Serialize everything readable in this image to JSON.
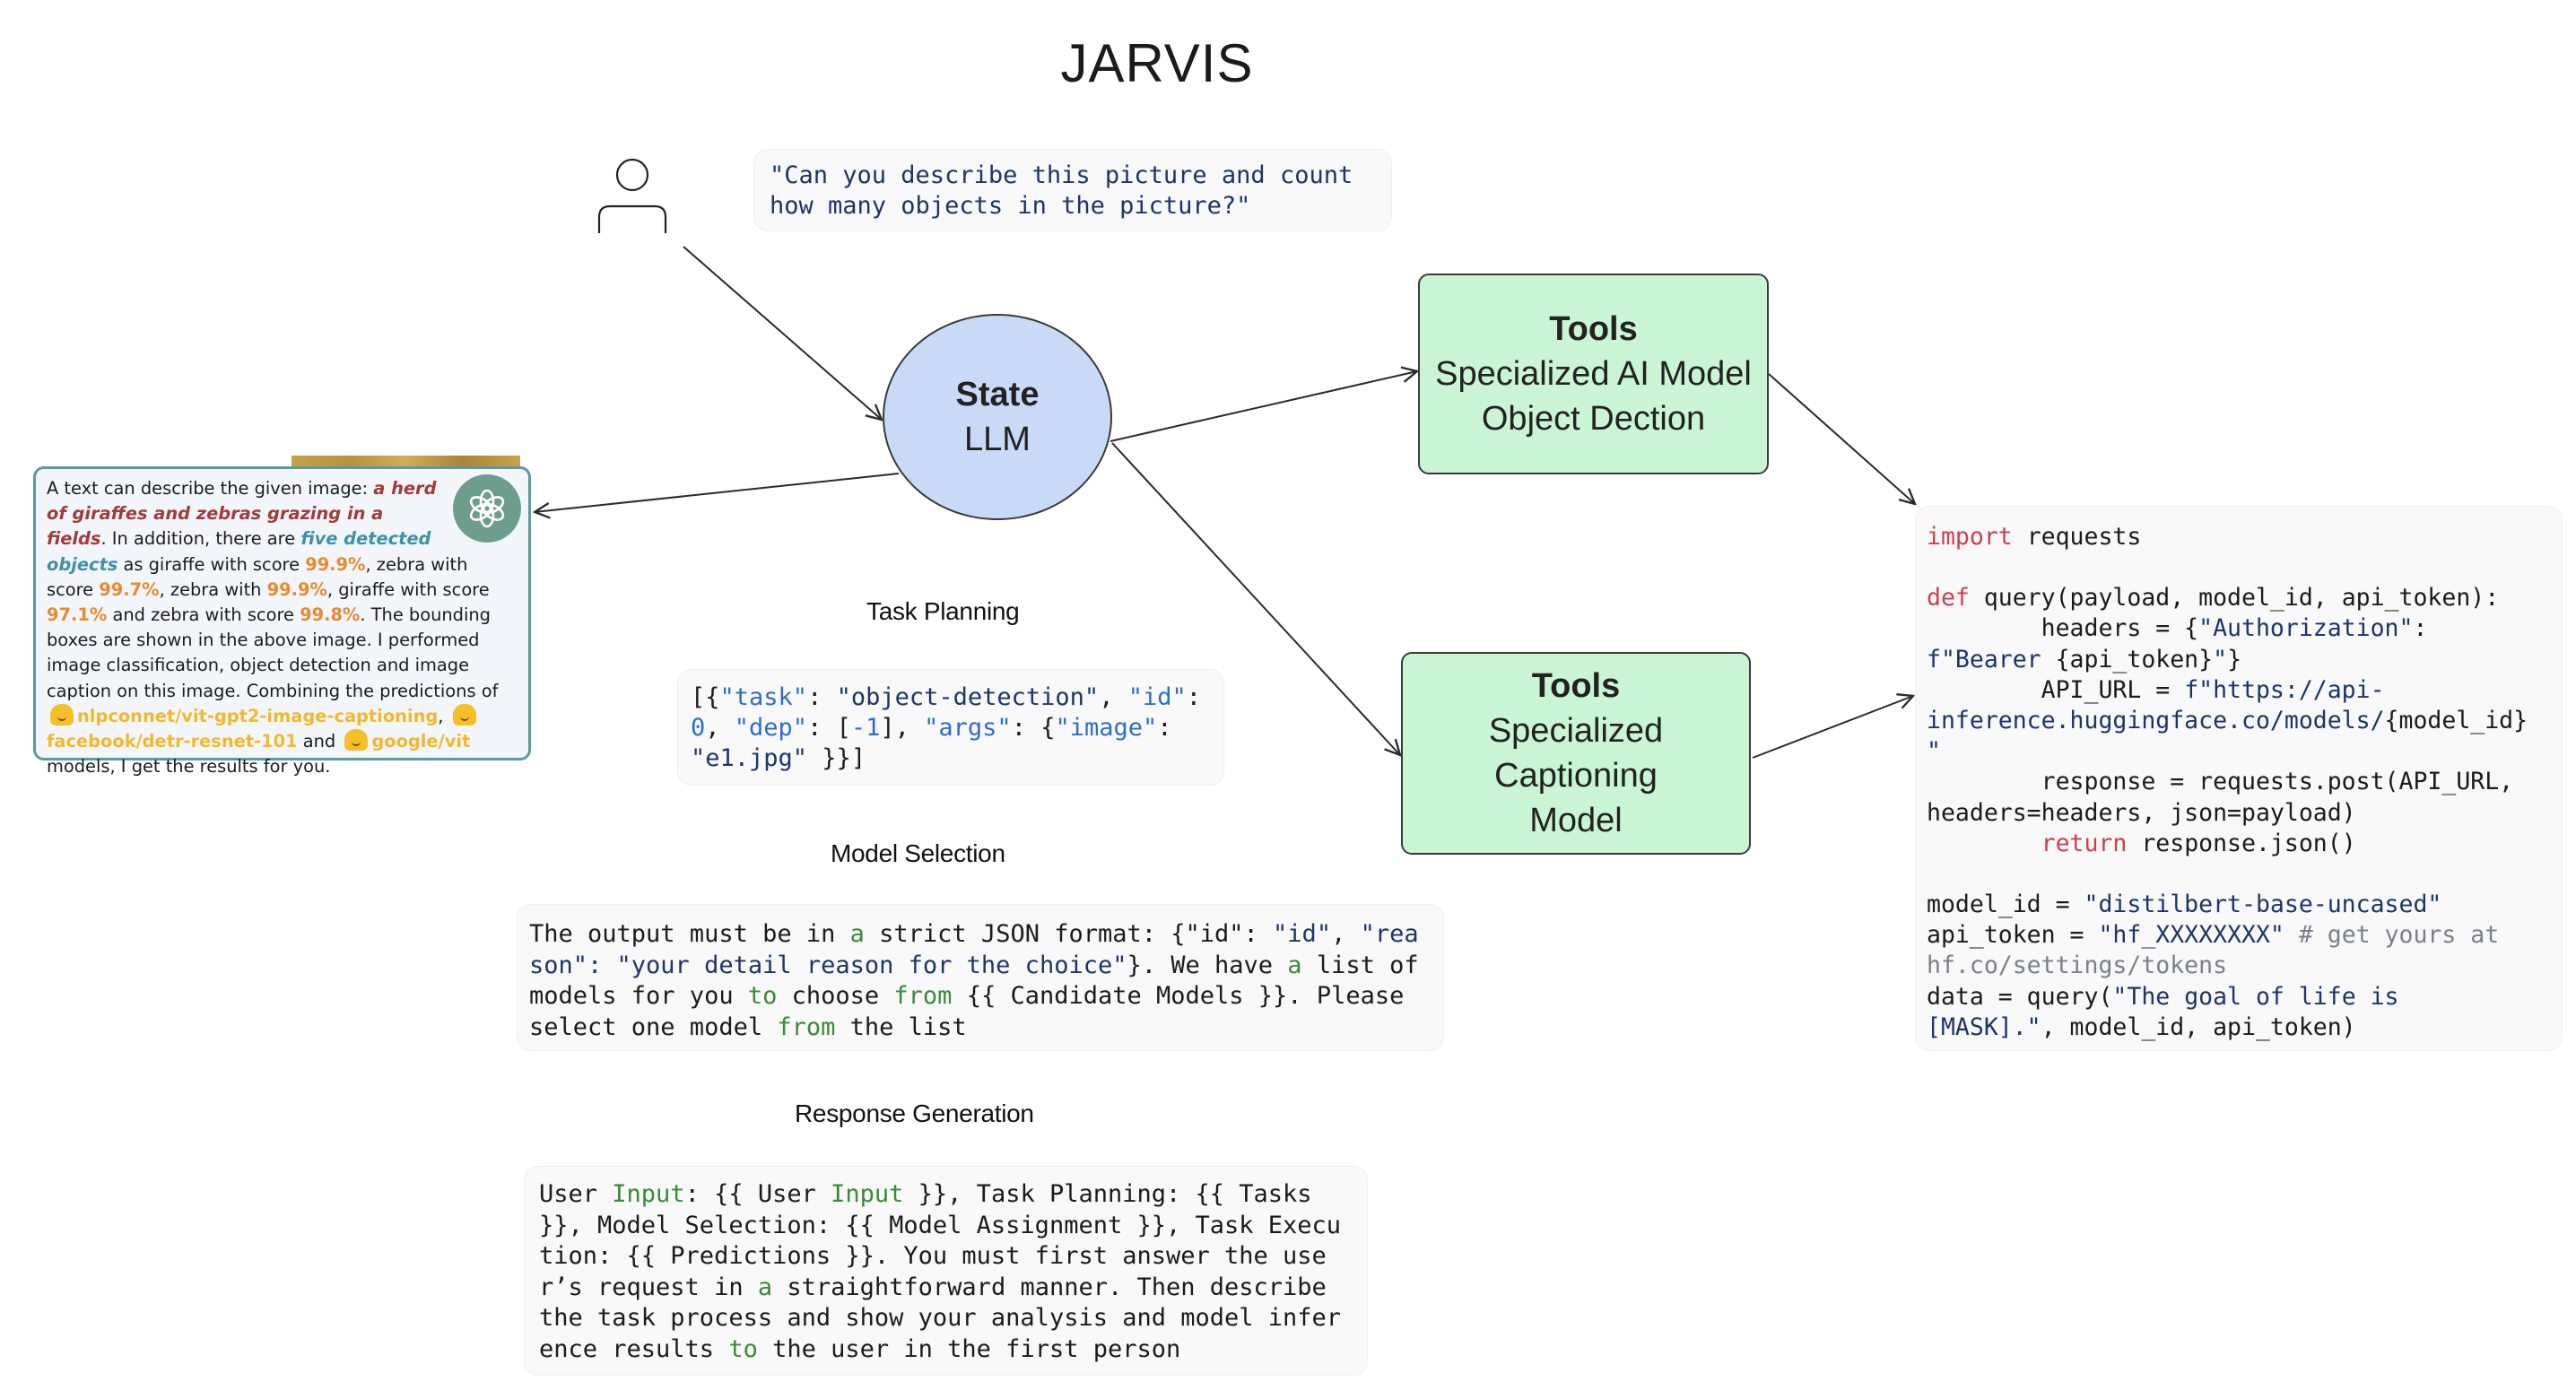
{
  "title": "JARVIS",
  "user_query": "\"Can you describe this picture and count how many objects in the picture?\"",
  "state_node": {
    "title": "State",
    "subtitle": "LLM",
    "color": "#c9daf6"
  },
  "tools": [
    {
      "title": "Tools",
      "lines": [
        "Specialized AI Model",
        "Object Dection"
      ],
      "color": "#c9f5d4"
    },
    {
      "title": "Tools",
      "lines": [
        "Specialized Captioning",
        "Model"
      ],
      "color": "#c9f5d4"
    }
  ],
  "sections": {
    "task_planning": {
      "label": "Task Planning",
      "tokens": [
        {
          "t": "[{",
          "c": ""
        },
        {
          "t": "\"task\"",
          "c": "key"
        },
        {
          "t": ": ",
          "c": ""
        },
        {
          "t": "\"object-detection\"",
          "c": "str"
        },
        {
          "t": ", ",
          "c": ""
        },
        {
          "t": "\"id\"",
          "c": "key"
        },
        {
          "t": ": ",
          "c": ""
        },
        {
          "t": "0",
          "c": "key"
        },
        {
          "t": ", ",
          "c": ""
        },
        {
          "t": "\"dep\"",
          "c": "key"
        },
        {
          "t": ": [",
          "c": ""
        },
        {
          "t": "-1",
          "c": "key"
        },
        {
          "t": "], ",
          "c": ""
        },
        {
          "t": "\"args\"",
          "c": "key"
        },
        {
          "t": ": {",
          "c": ""
        },
        {
          "t": "\"image\"",
          "c": "key"
        },
        {
          "t": ": ",
          "c": ""
        },
        {
          "t": "\"e1.jpg\"",
          "c": "str"
        },
        {
          "t": " }}]",
          "c": ""
        }
      ]
    },
    "model_selection": {
      "label": "Model Selection",
      "tokens": [
        {
          "t": "The output must be in ",
          "c": ""
        },
        {
          "t": "a",
          "c": "green"
        },
        {
          "t": " strict JSON format: {\"id\": ",
          "c": ""
        },
        {
          "t": "\"id\"",
          "c": "str"
        },
        {
          "t": ", ",
          "c": ""
        },
        {
          "t": "\"reason\": \"your detail reason for the choice\"",
          "c": "str"
        },
        {
          "t": "}. We have ",
          "c": ""
        },
        {
          "t": "a",
          "c": "green"
        },
        {
          "t": " list of models for you ",
          "c": ""
        },
        {
          "t": "to",
          "c": "green"
        },
        {
          "t": " choose ",
          "c": ""
        },
        {
          "t": "from",
          "c": "green"
        },
        {
          "t": " {{ Candidate Models }}. Please select one model ",
          "c": ""
        },
        {
          "t": "from",
          "c": "green"
        },
        {
          "t": " the list",
          "c": ""
        }
      ]
    },
    "response_generation": {
      "label": "Response Generation",
      "tokens": [
        {
          "t": "User ",
          "c": ""
        },
        {
          "t": "Input",
          "c": "green"
        },
        {
          "t": ": {{ User ",
          "c": ""
        },
        {
          "t": "Input",
          "c": "green"
        },
        {
          "t": " }}, Task Planning: {{ Tasks }}, Model Selection: {{ Model Assignment }}, Task Execution: {{ Predictions }}. You must first answer the user’s request in ",
          "c": ""
        },
        {
          "t": "a",
          "c": "green"
        },
        {
          "t": " straightforward manner. Then describe the task process and show your analysis and model inference results ",
          "c": ""
        },
        {
          "t": "to",
          "c": "green"
        },
        {
          "t": " the user in the first person",
          "c": ""
        }
      ]
    }
  },
  "code_snippet": {
    "lines": [
      [
        {
          "t": "import",
          "c": "kw"
        },
        {
          "t": " requests",
          "c": ""
        }
      ],
      [
        {
          "t": "",
          "c": ""
        }
      ],
      [
        {
          "t": "def",
          "c": "kw"
        },
        {
          "t": " query(payload, model_id, api_token):",
          "c": ""
        }
      ],
      [
        {
          "t": "        headers = {",
          "c": ""
        },
        {
          "t": "\"Authorization\"",
          "c": "str"
        },
        {
          "t": ": ",
          "c": ""
        }
      ],
      [
        {
          "t": "f\"Bearer ",
          "c": "str"
        },
        {
          "t": "{api_token}",
          "c": ""
        },
        {
          "t": "\"",
          "c": "str"
        },
        {
          "t": "}",
          "c": ""
        }
      ],
      [
        {
          "t": "        API_URL = ",
          "c": ""
        },
        {
          "t": "f\"https://api-",
          "c": "str"
        }
      ],
      [
        {
          "t": "inference.huggingface.co/models/",
          "c": "str"
        },
        {
          "t": "{model_id}",
          "c": ""
        }
      ],
      [
        {
          "t": "\"",
          "c": "str"
        }
      ],
      [
        {
          "t": "        response = requests.post(API_URL,",
          "c": ""
        }
      ],
      [
        {
          "t": "headers=headers, json=payload)",
          "c": ""
        }
      ],
      [
        {
          "t": "        ",
          "c": ""
        },
        {
          "t": "return",
          "c": "kw"
        },
        {
          "t": " response.json()",
          "c": ""
        }
      ],
      [
        {
          "t": "",
          "c": ""
        }
      ],
      [
        {
          "t": "model_id = ",
          "c": ""
        },
        {
          "t": "\"distilbert-base-uncased\"",
          "c": "str"
        }
      ],
      [
        {
          "t": "api_token = ",
          "c": ""
        },
        {
          "t": "\"hf_XXXXXXXX\"",
          "c": "str"
        },
        {
          "t": " # get yours at",
          "c": "cmt"
        }
      ],
      [
        {
          "t": "hf.co/settings/tokens",
          "c": "cmt"
        }
      ],
      [
        {
          "t": "data = query(",
          "c": ""
        },
        {
          "t": "\"The goal of life is",
          "c": "str"
        }
      ],
      [
        {
          "t": "[MASK].\"",
          "c": "str"
        },
        {
          "t": ", model_id, api_token)",
          "c": ""
        }
      ]
    ]
  },
  "response_card": {
    "segments": [
      {
        "t": "A text can describe the given image: ",
        "c": ""
      },
      {
        "t": "a herd of giraffes and zebras grazing in a fields",
        "c": "red"
      },
      {
        "t": ". In addition, there are ",
        "c": ""
      },
      {
        "t": "five detected objects",
        "c": "blue"
      },
      {
        "t": " as giraffe with score ",
        "c": ""
      },
      {
        "t": "99.9%",
        "c": "orange"
      },
      {
        "t": ", zebra with score ",
        "c": ""
      },
      {
        "t": "99.7%",
        "c": "orange"
      },
      {
        "t": ", zebra with ",
        "c": ""
      },
      {
        "t": "99.9%",
        "c": "orange"
      },
      {
        "t": ",  giraffe with score ",
        "c": ""
      },
      {
        "t": "97.1%",
        "c": "orange"
      },
      {
        "t": " and zebra with score ",
        "c": ""
      },
      {
        "t": "99.8%",
        "c": "orange"
      },
      {
        "t": ". The bounding boxes are shown in the above image. I performed image classification, object detection and image caption on this image. Combining the predictions of ",
        "c": ""
      },
      {
        "t": "",
        "c": "emoji"
      },
      {
        "t": "nlpconnet/vit-gpt2-image-captioning",
        "c": "yellow"
      },
      {
        "t": ", ",
        "c": ""
      },
      {
        "t": "",
        "c": "emoji"
      },
      {
        "t": "facebook/detr-resnet-101",
        "c": "yellow"
      },
      {
        "t": " and ",
        "c": ""
      },
      {
        "t": "",
        "c": "emoji"
      },
      {
        "t": "google/vit",
        "c": "yellow"
      },
      {
        "t": " models, I get the results for you.",
        "c": ""
      }
    ],
    "assistant_icon": "openai-logo-icon",
    "model_icon": "hugging-face-emoji-icon"
  },
  "icons": {
    "user": "user-icon",
    "assistant": "openai-logo-icon"
  },
  "colors": {
    "state_fill": "#c9daf6",
    "tools_fill": "#c9f5d4",
    "code_bg": "#f8f8f8",
    "keyword": "#cf3f4f",
    "string": "#1d3567",
    "json_key": "#2f6ec7",
    "green_token": "#3a8a3a",
    "card_border": "#5b9aa0"
  }
}
